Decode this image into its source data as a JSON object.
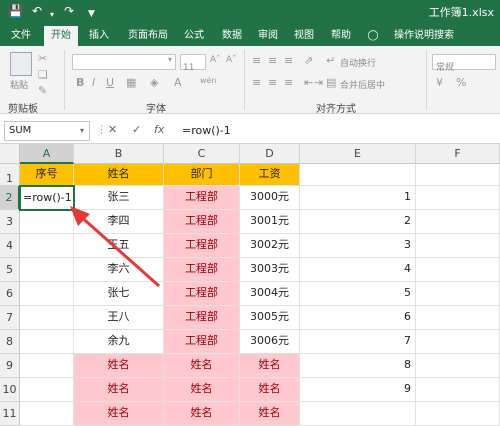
{
  "titlebar": {
    "title": "工作簿1.xlsx",
    "save_icon": "save-icon",
    "undo_icon": "undo-icon",
    "redo_icon": "redo-icon",
    "customize_icon": "customize-icon"
  },
  "tabs": [
    "文件",
    "开始",
    "插入",
    "页面布局",
    "公式",
    "数据",
    "审阅",
    "视图",
    "帮助",
    "操作说明搜索"
  ],
  "active_tab": "开始",
  "ribbon": {
    "paste_label": "粘贴",
    "clipboard_label": "剪贴板",
    "font_label": "字体",
    "font_size": "11",
    "align_label": "对齐方式",
    "wrap_text": "自动换行",
    "merge_center": "合并后居中",
    "number_format": "常规",
    "bold": "B",
    "italic": "I",
    "underline": "U",
    "font_color_glyph": "A",
    "wen_glyph": "wén"
  },
  "formula_bar": {
    "name_box": "SUM",
    "cancel": "✕",
    "confirm": "✓",
    "fx": "fx",
    "formula": "=row()-1"
  },
  "columns": [
    "A",
    "B",
    "C",
    "D",
    "E",
    "F"
  ],
  "rows": [
    "1",
    "2",
    "3",
    "4",
    "5",
    "6",
    "7",
    "8",
    "9",
    "10",
    "11"
  ],
  "header_row": [
    "序号",
    "姓名",
    "部门",
    "工资"
  ],
  "data_rows": [
    {
      "name": "张三",
      "dept": "工程部",
      "salary": "3000元",
      "e": "1"
    },
    {
      "name": "李四",
      "dept": "工程部",
      "salary": "3001元",
      "e": "2"
    },
    {
      "name": "王五",
      "dept": "工程部",
      "salary": "3002元",
      "e": "3"
    },
    {
      "name": "李六",
      "dept": "工程部",
      "salary": "3003元",
      "e": "4"
    },
    {
      "name": "张七",
      "dept": "工程部",
      "salary": "3004元",
      "e": "5"
    },
    {
      "name": "王八",
      "dept": "工程部",
      "salary": "3005元",
      "e": "6"
    },
    {
      "name": "余九",
      "dept": "工程部",
      "salary": "3006元",
      "e": "7"
    }
  ],
  "repeat_rows": [
    {
      "b": "姓名",
      "c": "姓名",
      "d": "姓名",
      "e": "8"
    },
    {
      "b": "姓名",
      "c": "姓名",
      "d": "姓名",
      "e": "9"
    },
    {
      "b": "姓名",
      "c": "姓名",
      "d": "姓名",
      "e": ""
    }
  ],
  "active_cell_text": "=row()-1",
  "colors": {
    "excel_green": "#217346",
    "header_fill": "#ffc000",
    "pink_fill": "#ffc7ce",
    "pink_text": "#9c0006",
    "arrow": "#e53935"
  }
}
